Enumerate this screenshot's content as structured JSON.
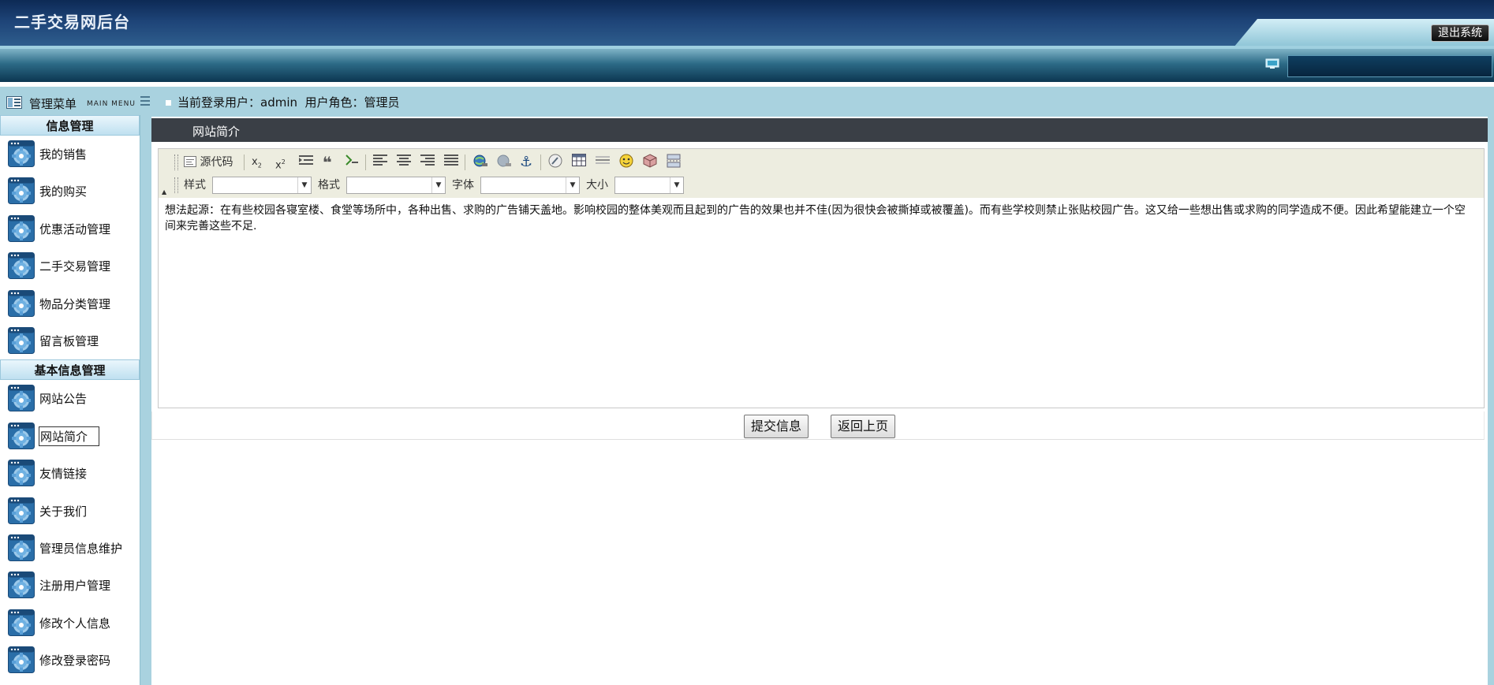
{
  "app": {
    "title": "二手交易网后台",
    "logout_label": "退出系统"
  },
  "menu": {
    "title": "管理菜单",
    "subtitle": "MAIN MENU",
    "sections": [
      {
        "title": "信息管理",
        "items": [
          "我的销售",
          "我的购买",
          "优惠活动管理",
          "二手交易管理",
          "物品分类管理",
          "留言板管理"
        ]
      },
      {
        "title": "基本信息管理",
        "items": [
          "网站公告",
          "网站简介",
          "友情链接",
          "关于我们",
          "管理员信息维护",
          "注册用户管理",
          "修改个人信息",
          "修改登录密码"
        ]
      }
    ],
    "active_item": "网站简介"
  },
  "user_bar": {
    "label": "当前登录用户：admin  用户角色：管理员"
  },
  "content": {
    "title": "网站简介"
  },
  "editor": {
    "source_label": "源代码",
    "style_label": "样式",
    "format_label": "格式",
    "font_label": "字体",
    "size_label": "大小",
    "text": "想法起源：在有些校园各寝室楼、食堂等场所中，各种出售、求购的广告铺天盖地。影响校园的整体美观而且起到的广告的效果也并不佳(因为很快会被撕掉或被覆盖)。而有些学校则禁止张贴校园广告。这又给一些想出售或求购的同学造成不便。因此希望能建立一个空间来完善这些不足."
  },
  "actions": {
    "submit_label": "提交信息",
    "back_label": "返回上页"
  },
  "icons": {
    "menu": "menu-icon",
    "gear": "gear-icon",
    "monitor": "monitor-icon"
  },
  "colors": {
    "header": "#1e4478",
    "frame": "#a9d2df",
    "content_bar": "#3a3f46",
    "toolbar": "#edede0"
  }
}
